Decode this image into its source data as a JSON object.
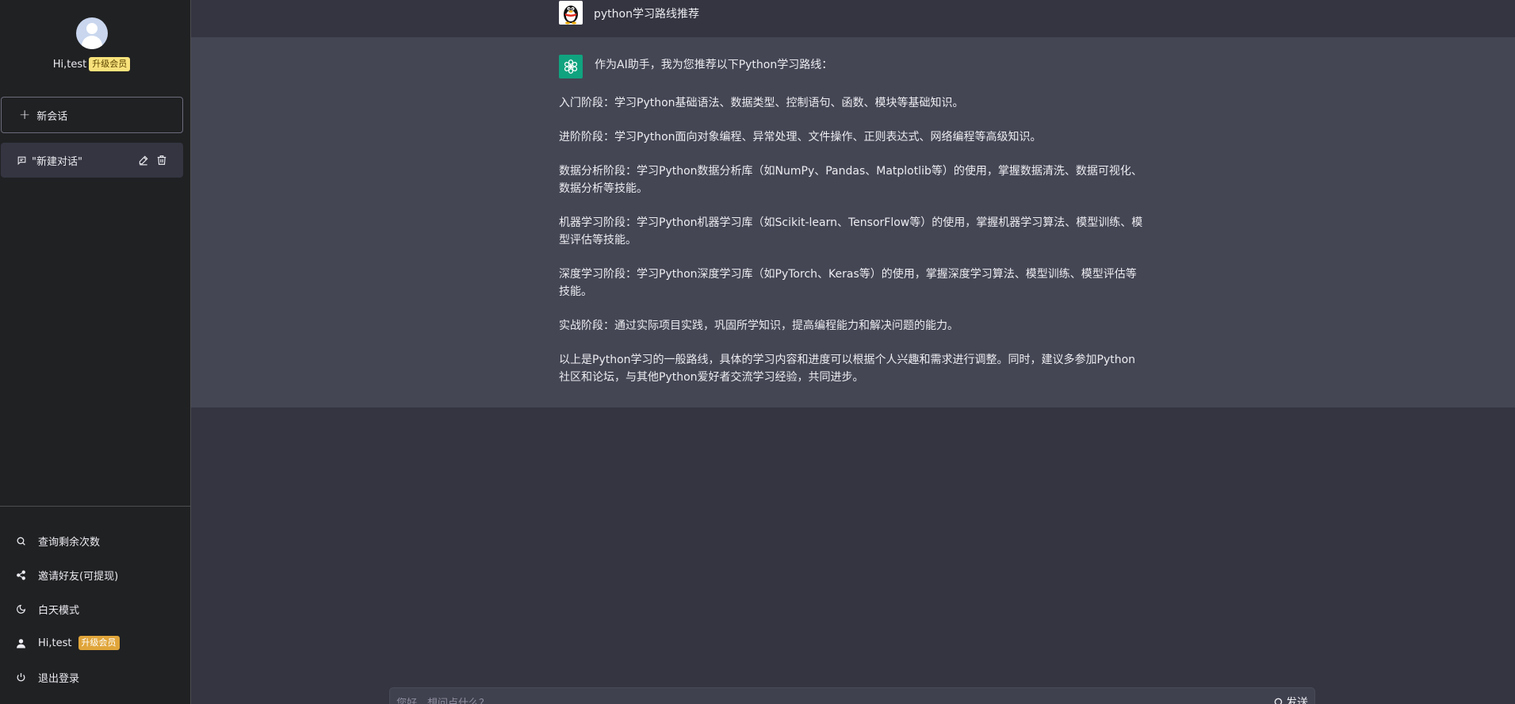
{
  "sidebar": {
    "profile": {
      "greeting": "Hi,test",
      "badge": "升级会员"
    },
    "new_chat_label": "新会话",
    "conversation": {
      "label": "\"新建对话\""
    },
    "footer": {
      "items": [
        {
          "label": "查询剩余次数",
          "icon": "search-icon"
        },
        {
          "label": "邀请好友(可提现)",
          "icon": "share-icon"
        },
        {
          "label": "白天模式",
          "icon": "moon-icon"
        },
        {
          "label": "Hi,test",
          "icon": "user-icon",
          "badge": "升级会员"
        },
        {
          "label": "退出登录",
          "icon": "power-icon"
        }
      ]
    }
  },
  "chat": {
    "user_message": "python学习路线推荐",
    "ai_paragraphs": [
      "作为AI助手，我为您推荐以下Python学习路线：",
      "入门阶段：学习Python基础语法、数据类型、控制语句、函数、模块等基础知识。",
      "进阶阶段：学习Python面向对象编程、异常处理、文件操作、正则表达式、网络编程等高级知识。",
      "数据分析阶段：学习Python数据分析库（如NumPy、Pandas、Matplotlib等）的使用，掌握数据清洗、数据可视化、数据分析等技能。",
      "机器学习阶段：学习Python机器学习库（如Scikit-learn、TensorFlow等）的使用，掌握机器学习算法、模型训练、模型评估等技能。",
      "深度学习阶段：学习Python深度学习库（如PyTorch、Keras等）的使用，掌握深度学习算法、模型训练、模型评估等技能。",
      "实战阶段：通过实际项目实践，巩固所学知识，提高编程能力和解决问题的能力。",
      "以上是Python学习的一般路线，具体的学习内容和进度可以根据个人兴趣和需求进行调整。同时，建议多参加Python社区和论坛，与其他Python爱好者交流学习经验，共同进步。"
    ]
  },
  "input": {
    "placeholder": "您好，想问点什么？",
    "value": "",
    "send_label": "发送"
  },
  "colors": {
    "sidebar_bg": "#202123",
    "main_bg": "#343541",
    "ai_bg": "#444654",
    "ai_avatar": "#10a37f",
    "badge_light": "#f9e27b",
    "badge_gold": "#e0a53a"
  }
}
